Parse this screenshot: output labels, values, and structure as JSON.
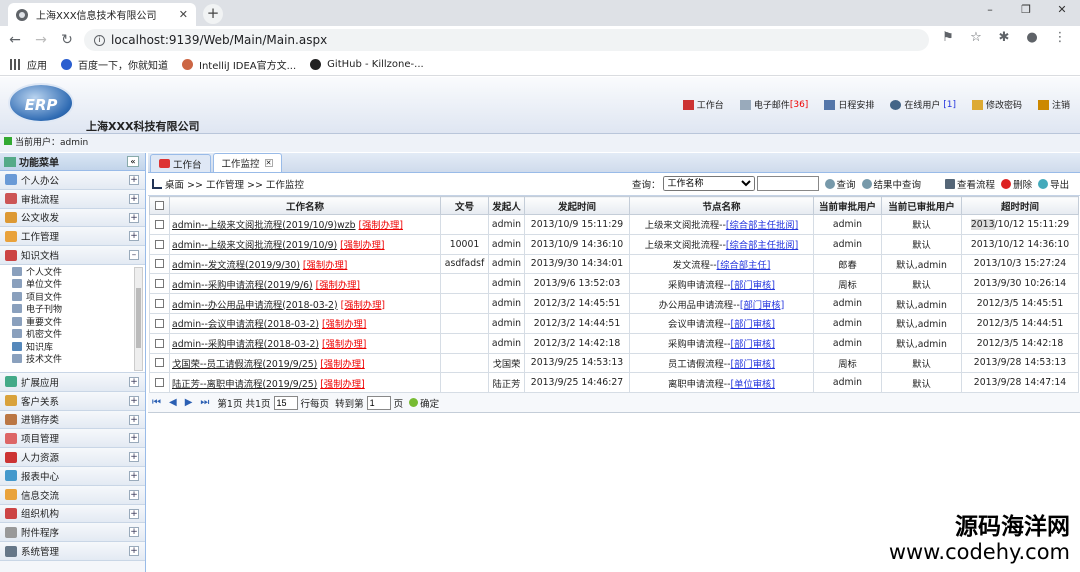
{
  "browser": {
    "tab_title": "上海XXX信息技术有限公司",
    "url": "localhost:9139/Web/Main/Main.aspx",
    "bookmarks": [
      "应用",
      "百度一下，你就知道",
      "IntelliJ IDEA官方文...",
      "GitHub - Killzone-..."
    ]
  },
  "header": {
    "logo_text": "ERP",
    "company": "上海XXX科技有限公司",
    "menu": [
      "工作台",
      "电子邮件",
      "[36]",
      "日程安排",
      "在线用户",
      "[1]",
      "修改密码",
      "注销"
    ]
  },
  "userbar": {
    "label": "当前用户：",
    "user": "admin"
  },
  "sidebar": {
    "title": "功能菜单",
    "top_items": [
      "个人办公",
      "审批流程",
      "公文收发",
      "工作管理",
      "知识文档"
    ],
    "sub_items": [
      "个人文件",
      "单位文件",
      "项目文件",
      "电子刊物",
      "重要文件",
      "机密文件",
      "知识库",
      "技术文件"
    ],
    "bottom_items": [
      "扩展应用",
      "客户关系",
      "进销存类",
      "项目管理",
      "人力资源",
      "报表中心",
      "信息交流",
      "组织机构",
      "附件程序",
      "系统管理"
    ]
  },
  "tabs": [
    "工作台",
    "工作监控"
  ],
  "toolbar": {
    "breadcrumb": "桌面 >> 工作管理 >> 工作监控",
    "query_label": "查询：",
    "query_select": "工作名称",
    "buttons": [
      "查询",
      "结果中查询",
      "查看流程",
      "删除",
      "导出"
    ]
  },
  "grid": {
    "columns": [
      "工作名称",
      "文号",
      "发起人",
      "发起时间",
      "节点名称",
      "当前审批用户",
      "当前已审批用户",
      "超时时间"
    ],
    "rows": [
      {
        "name": "admin--上级来文阅批流程(2019/10/9)wzb",
        "force": "[强制办理]",
        "doc": "",
        "starter": "admin",
        "time": "2013/10/9 15:11:29",
        "node": "上级来文阅批流程--",
        "node_link": "[综合部主任批阅]",
        "cur": "admin",
        "done": "默认",
        "timeout_hl": "2013",
        "timeout": "/10/12 15:11:29"
      },
      {
        "name": "admin--上级来文阅批流程(2019/10/9)",
        "force": "[强制办理]",
        "doc": "10001",
        "starter": "admin",
        "time": "2013/10/9 14:36:10",
        "node": "上级来文阅批流程--",
        "node_link": "[综合部主任批阅]",
        "cur": "admin",
        "done": "默认",
        "timeout_hl": "",
        "timeout": "2013/10/12 14:36:10"
      },
      {
        "name": "admin--发文流程(2019/9/30)",
        "force": "[强制办理]",
        "doc": "asdfadsf",
        "starter": "admin",
        "time": "2013/9/30 14:34:01",
        "node": "发文流程--",
        "node_link": "[综合部主任]",
        "cur": "郎春",
        "done": "默认,admin",
        "timeout_hl": "",
        "timeout": "2013/10/3 15:27:24"
      },
      {
        "name": "admin--采购申请流程(2019/9/6)",
        "force": "[强制办理]",
        "doc": "",
        "starter": "admin",
        "time": "2013/9/6 13:52:03",
        "node": "采购申请流程--",
        "node_link": "[部门审核]",
        "cur": "周标",
        "done": "默认",
        "timeout_hl": "",
        "timeout": "2013/9/30 10:26:14"
      },
      {
        "name": "admin--办公用品申请流程(2018-03-2)",
        "force": "[强制办理]",
        "doc": "",
        "starter": "admin",
        "time": "2012/3/2 14:45:51",
        "node": "办公用品申请流程--",
        "node_link": "[部门审核]",
        "cur": "admin",
        "done": "默认,admin",
        "timeout_hl": "",
        "timeout": "2012/3/5 14:45:51"
      },
      {
        "name": "admin--会议申请流程(2018-03-2)",
        "force": "[强制办理]",
        "doc": "",
        "starter": "admin",
        "time": "2012/3/2 14:44:51",
        "node": "会议申请流程--",
        "node_link": "[部门审核]",
        "cur": "admin",
        "done": "默认,admin",
        "timeout_hl": "",
        "timeout": "2012/3/5 14:44:51"
      },
      {
        "name": "admin--采购申请流程(2018-03-2)",
        "force": "[强制办理]",
        "doc": "",
        "starter": "admin",
        "time": "2012/3/2 14:42:18",
        "node": "采购申请流程--",
        "node_link": "[部门审核]",
        "cur": "admin",
        "done": "默认,admin",
        "timeout_hl": "",
        "timeout": "2012/3/5 14:42:18"
      },
      {
        "name": "戈国荣--员工请假流程(2019/9/25)",
        "force": "[强制办理]",
        "doc": "",
        "starter": "戈国荣",
        "time": "2013/9/25 14:53:13",
        "node": "员工请假流程--",
        "node_link": "[部门审核]",
        "cur": "周标",
        "done": "默认",
        "timeout_hl": "",
        "timeout": "2013/9/28 14:53:13"
      },
      {
        "name": "陆正芳--离职申请流程(2019/9/25)",
        "force": "[强制办理]",
        "doc": "",
        "starter": "陆正芳",
        "time": "2013/9/25 14:46:27",
        "node": "离职申请流程--",
        "node_link": "[单位审核]",
        "cur": "admin",
        "done": "默认",
        "timeout_hl": "",
        "timeout": "2013/9/28 14:47:14"
      }
    ]
  },
  "pager": {
    "page": "第1页",
    "total": "共1页",
    "per_page_value": "15",
    "per_page_label": "行每页",
    "goto_label": "转到第",
    "goto_value": "1",
    "page_unit": "页",
    "ok": "确定"
  },
  "watermark": {
    "line1": "源码海洋网",
    "line2": "www.codehy.com"
  },
  "colors": {
    "accent": "#99bbe8",
    "force_red": "#e00000",
    "link_blue": "#2233dd"
  }
}
